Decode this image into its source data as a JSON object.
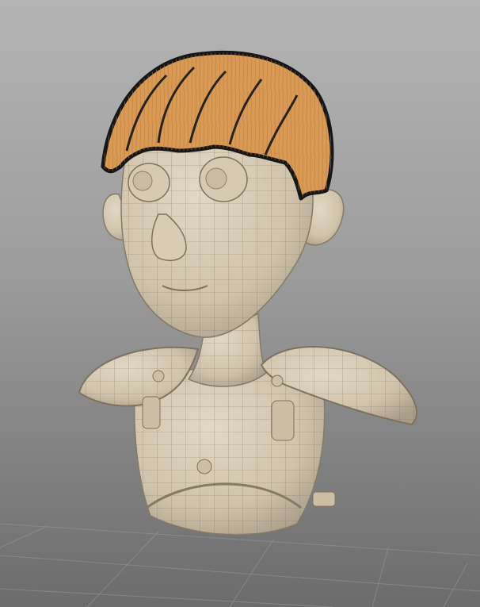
{
  "viewport": {
    "background_top": "#b4b4b4",
    "background_bottom": "#6c6c6c",
    "grid_color": "#9a9a9a"
  },
  "model": {
    "skin_color": "#d3c7b1",
    "skin_shadow": "#a99d88",
    "wire_color": "#6f6658",
    "hair_color": "#d99a55",
    "hair_shadow": "#161616"
  },
  "icons": {
    "model": "character-bust-icon",
    "grid": "grid-floor-icon"
  }
}
